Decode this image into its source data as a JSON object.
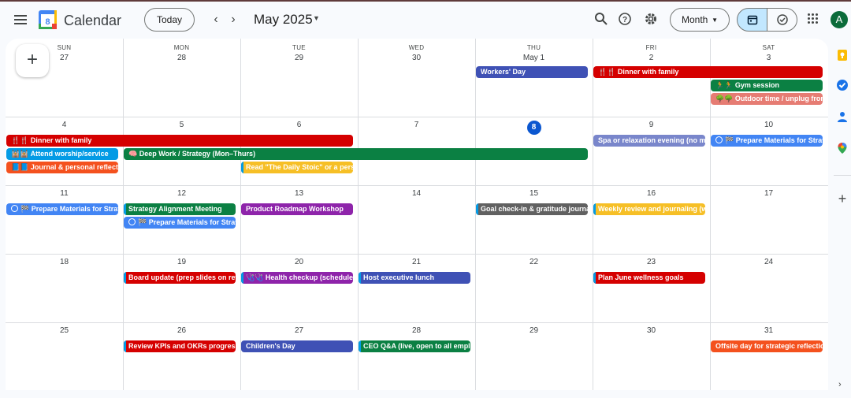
{
  "header": {
    "app_title": "Calendar",
    "logo_day": "8",
    "today_label": "Today",
    "month_year": "May 2025",
    "view_label": "Month",
    "avatar_letter": "A"
  },
  "days_of_week": [
    "SUN",
    "MON",
    "TUE",
    "WED",
    "THU",
    "FRI",
    "SAT"
  ],
  "weeks": [
    [
      "27",
      "28",
      "29",
      "30",
      "May 1",
      "2",
      "3"
    ],
    [
      "4",
      "5",
      "6",
      "7",
      "8",
      "9",
      "10"
    ],
    [
      "11",
      "12",
      "13",
      "14",
      "15",
      "16",
      "17"
    ],
    [
      "18",
      "19",
      "20",
      "21",
      "22",
      "23",
      "24"
    ],
    [
      "25",
      "26",
      "27",
      "28",
      "29",
      "30",
      "31"
    ]
  ],
  "today_date": "8",
  "colors": {
    "accent": "#0b57d0",
    "red": "#d50000",
    "green": "#0b8043",
    "blue": "#3f51b5",
    "orange": "#f4511e",
    "yellow": "#f6bf26",
    "lavender": "#7986cb",
    "grape": "#8e24aa",
    "graphite": "#616161",
    "peacock": "#039be5",
    "flamingo": "#e67c73"
  },
  "events": [
    {
      "week": 0,
      "day": 4,
      "span": 1,
      "row": 0,
      "title": "Workers' Day",
      "color": "#3f51b5"
    },
    {
      "week": 0,
      "day": 5,
      "span": 2,
      "row": 0,
      "title": "🍴🍴 Dinner with family",
      "color": "#d50000"
    },
    {
      "week": 0,
      "day": 6,
      "span": 1,
      "row": 1,
      "title": "🏃🏃 Gym session",
      "color": "#0b8043"
    },
    {
      "week": 0,
      "day": 6,
      "span": 1,
      "row": 2,
      "title": "🌳🌳 Outdoor time / unplug from",
      "color": "#e67c73"
    },
    {
      "week": 1,
      "day": 0,
      "span": 3,
      "row": 0,
      "title": "🍴🍴 Dinner with family",
      "color": "#d50000"
    },
    {
      "week": 1,
      "day": 0,
      "span": 1,
      "row": 1,
      "title": "🕍🕍 Attend worship/service",
      "color": "#039be5"
    },
    {
      "week": 1,
      "day": 1,
      "span": 4,
      "row": 1,
      "title": "🧠 Deep Work / Strategy (Mon–Thurs)",
      "color": "#0b8043"
    },
    {
      "week": 1,
      "day": 0,
      "span": 1,
      "row": 2,
      "title": "📘📘 Journal & personal reflect",
      "color": "#f4511e"
    },
    {
      "week": 1,
      "day": 2,
      "span": 1,
      "row": 2,
      "title": "Read \"The Daily Stoic\" or a pers",
      "color": "#f6bf26",
      "stripe": true
    },
    {
      "week": 1,
      "day": 5,
      "span": 1,
      "row": 0,
      "title": "Spa or relaxation evening (no me",
      "color": "#7986cb"
    },
    {
      "week": 1,
      "day": 6,
      "span": 1,
      "row": 0,
      "title": "🏁 Prepare Materials for Strat",
      "task": true
    },
    {
      "week": 2,
      "day": 0,
      "span": 1,
      "row": 0,
      "title": "🏁 Prepare Materials for Strat",
      "task": true
    },
    {
      "week": 2,
      "day": 1,
      "span": 1,
      "row": 0,
      "title": "Strategy Alignment Meeting",
      "color": "#0b8043",
      "stripe": true
    },
    {
      "week": 2,
      "day": 1,
      "span": 1,
      "row": 1,
      "title": "🏁 Prepare Materials for Strat",
      "task": true
    },
    {
      "week": 2,
      "day": 2,
      "span": 1,
      "row": 0,
      "title": "Product Roadmap Workshop",
      "color": "#8e24aa"
    },
    {
      "week": 2,
      "day": 4,
      "span": 1,
      "row": 0,
      "title": "Goal check-in & gratitude journa",
      "color": "#616161",
      "stripe": true
    },
    {
      "week": 2,
      "day": 5,
      "span": 1,
      "row": 0,
      "title": "Weekly review and journaling (wi",
      "color": "#f6bf26",
      "stripe": true
    },
    {
      "week": 3,
      "day": 1,
      "span": 1,
      "row": 0,
      "title": "Board update (prep slides on rev",
      "color": "#d50000",
      "stripe": true
    },
    {
      "week": 3,
      "day": 2,
      "span": 1,
      "row": 0,
      "title": "🩺🩺 Health checkup (schedule",
      "color": "#8e24aa",
      "stripe": true
    },
    {
      "week": 3,
      "day": 3,
      "span": 1,
      "row": 0,
      "title": "Host executive lunch",
      "color": "#3f51b5",
      "stripe": true
    },
    {
      "week": 3,
      "day": 5,
      "span": 1,
      "row": 0,
      "title": "Plan June wellness goals",
      "color": "#d50000",
      "stripe": true
    },
    {
      "week": 4,
      "day": 1,
      "span": 1,
      "row": 0,
      "title": "Review KPIs and OKRs progress",
      "color": "#d50000",
      "stripe": true
    },
    {
      "week": 4,
      "day": 2,
      "span": 1,
      "row": 0,
      "title": "Children's Day",
      "color": "#3f51b5"
    },
    {
      "week": 4,
      "day": 3,
      "span": 1,
      "row": 0,
      "title": "CEO Q&A (live, open to all emplo",
      "color": "#0b8043",
      "stripe": true
    },
    {
      "week": 4,
      "day": 6,
      "span": 1,
      "row": 0,
      "title": "Offsite day for strategic reflectio",
      "color": "#f4511e"
    }
  ],
  "side_panel_icons": [
    "keep-icon",
    "tasks-icon",
    "contacts-icon",
    "maps-icon",
    "add-icon"
  ]
}
